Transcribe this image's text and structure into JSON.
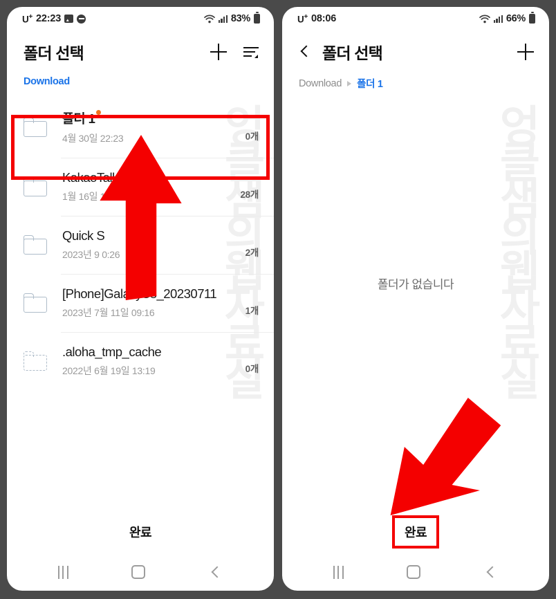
{
  "left_screen": {
    "statusbar": {
      "carrier": "U",
      "carrier_sup": "+",
      "time": "22:23",
      "battery": "83%",
      "icons": [
        "gallery-icon",
        "do-not-disturb-icon",
        "wifi-icon",
        "signal-icon",
        "battery-icon"
      ]
    },
    "appbar": {
      "title": "폴더 선택",
      "add_icon": "plus-icon",
      "sort_icon": "sort-icon"
    },
    "breadcrumb": {
      "root": "Download"
    },
    "rows": [
      {
        "name": "폴더 1",
        "korean": true,
        "badge": true,
        "date": "4월 30일 22:23",
        "count": "0개",
        "dashed": false
      },
      {
        "name": "KakaoTalk",
        "korean": false,
        "badge": false,
        "date": "1월 16일 1",
        "count": "28개",
        "dashed": false
      },
      {
        "name": "Quick S",
        "korean": false,
        "badge": false,
        "date": "2023년 9          0:26",
        "count": "2개",
        "dashed": false
      },
      {
        "name": "[Phone]GalaxyS8_20230711",
        "korean": false,
        "badge": false,
        "date": "2023년 7월 11일 09:16",
        "count": "1개",
        "dashed": false
      },
      {
        "name": ".aloha_tmp_cache",
        "korean": false,
        "badge": false,
        "date": "2022년 6월 19일 13:19",
        "count": "0개",
        "dashed": true
      }
    ],
    "done_label": "완료",
    "navbar": [
      "recents-icon",
      "home-icon",
      "back-icon"
    ],
    "watermark": "엉클샘의웹자료실",
    "highlight_color": "#f40000"
  },
  "right_screen": {
    "statusbar": {
      "carrier": "U",
      "carrier_sup": "+",
      "time": "08:06",
      "battery": "66%",
      "icons": [
        "wifi-icon",
        "signal-icon",
        "battery-icon"
      ]
    },
    "appbar": {
      "back_icon": "chevron-left-icon",
      "title": "폴더 선택",
      "add_icon": "plus-icon"
    },
    "breadcrumb": {
      "root": "Download",
      "separator": "chevron-right-icon",
      "current": "폴더 1"
    },
    "empty_text": "폴더가 없습니다",
    "done_label": "완료",
    "navbar": [
      "recents-icon",
      "home-icon",
      "back-icon"
    ],
    "watermark": "엉클샘의웹자료실",
    "highlight_color": "#f40000"
  }
}
